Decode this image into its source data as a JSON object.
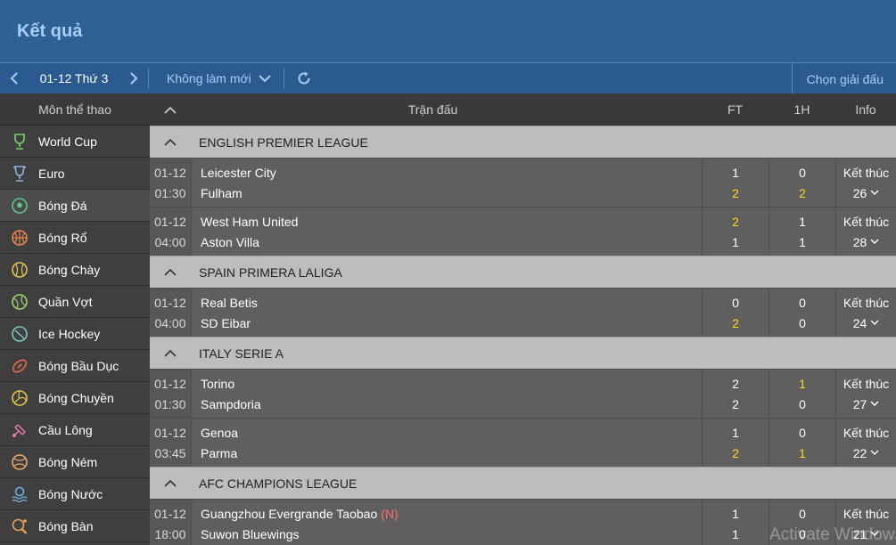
{
  "header": {
    "title": "Kết quả"
  },
  "toolbar": {
    "date": "01-12 Thứ 3",
    "refresh_mode": "Không làm mới",
    "choose_league": "Chọn giải đấu"
  },
  "sidebar": {
    "heading": "Môn thể thao",
    "items": [
      {
        "label": "World Cup",
        "icon": "trophy-icon",
        "active": false
      },
      {
        "label": "Euro",
        "icon": "cup-icon",
        "active": false
      },
      {
        "label": "Bóng Đá",
        "icon": "soccer-ball-icon",
        "active": true
      },
      {
        "label": "Bóng Rổ",
        "icon": "basketball-icon",
        "active": false
      },
      {
        "label": "Bóng Chày",
        "icon": "baseball-icon",
        "active": false
      },
      {
        "label": "Quần Vợt",
        "icon": "tennis-ball-icon",
        "active": false
      },
      {
        "label": "Ice Hockey",
        "icon": "hockey-puck-icon",
        "active": false
      },
      {
        "label": "Bóng Bầu Dục",
        "icon": "rugby-ball-icon",
        "active": false
      },
      {
        "label": "Bóng Chuyền",
        "icon": "volleyball-icon",
        "active": false
      },
      {
        "label": "Cầu Lông",
        "icon": "shuttlecock-icon",
        "active": false
      },
      {
        "label": "Bóng Ném",
        "icon": "handball-icon",
        "active": false
      },
      {
        "label": "Bóng Nước",
        "icon": "water-polo-icon",
        "active": false
      },
      {
        "label": "Bóng Bàn",
        "icon": "table-tennis-icon",
        "active": false
      }
    ]
  },
  "table": {
    "columns": {
      "match": "Trận đấu",
      "ft": "FT",
      "h1": "1H",
      "info": "Info"
    },
    "leagues": [
      {
        "name": "ENGLISH PREMIER LEAGUE",
        "matches": [
          {
            "date": "01-12",
            "time": "01:30",
            "home": "Leicester City",
            "away": "Fulham",
            "ft_home": "1",
            "ft_away": "2",
            "h1_home": "0",
            "h1_away": "2",
            "status": "Kết thúc",
            "count": "26",
            "ft_home_hl": false,
            "ft_away_hl": true,
            "h1_home_hl": false,
            "h1_away_hl": true,
            "neutral": ""
          },
          {
            "date": "01-12",
            "time": "04:00",
            "home": "West Ham United",
            "away": "Aston Villa",
            "ft_home": "2",
            "ft_away": "1",
            "h1_home": "1",
            "h1_away": "1",
            "status": "Kết thúc",
            "count": "28",
            "ft_home_hl": true,
            "ft_away_hl": false,
            "h1_home_hl": false,
            "h1_away_hl": false,
            "neutral": ""
          }
        ]
      },
      {
        "name": "SPAIN PRIMERA LALIGA",
        "matches": [
          {
            "date": "01-12",
            "time": "04:00",
            "home": "Real Betis",
            "away": "SD Eibar",
            "ft_home": "0",
            "ft_away": "2",
            "h1_home": "0",
            "h1_away": "0",
            "status": "Kết thúc",
            "count": "24",
            "ft_home_hl": false,
            "ft_away_hl": true,
            "h1_home_hl": false,
            "h1_away_hl": false,
            "neutral": ""
          }
        ]
      },
      {
        "name": "ITALY SERIE A",
        "matches": [
          {
            "date": "01-12",
            "time": "01:30",
            "home": "Torino",
            "away": "Sampdoria",
            "ft_home": "2",
            "ft_away": "2",
            "h1_home": "1",
            "h1_away": "0",
            "status": "Kết thúc",
            "count": "27",
            "ft_home_hl": false,
            "ft_away_hl": false,
            "h1_home_hl": true,
            "h1_away_hl": false,
            "neutral": ""
          },
          {
            "date": "01-12",
            "time": "03:45",
            "home": "Genoa",
            "away": "Parma",
            "ft_home": "1",
            "ft_away": "2",
            "h1_home": "0",
            "h1_away": "1",
            "status": "Kết thúc",
            "count": "22",
            "ft_home_hl": false,
            "ft_away_hl": true,
            "h1_home_hl": false,
            "h1_away_hl": true,
            "neutral": ""
          }
        ]
      },
      {
        "name": "AFC CHAMPIONS LEAGUE",
        "matches": [
          {
            "date": "01-12",
            "time": "18:00",
            "home": "Guangzhou Evergrande Taobao",
            "away": "Suwon Bluewings",
            "ft_home": "1",
            "ft_away": "1",
            "h1_home": "0",
            "h1_away": "0",
            "status": "Kết thúc",
            "count": "21",
            "ft_home_hl": false,
            "ft_away_hl": false,
            "h1_home_hl": false,
            "h1_away_hl": false,
            "neutral": "(N)"
          }
        ]
      }
    ]
  },
  "watermark": "Activate Windows",
  "colors": {
    "header_bg": "#2e6196",
    "title": "#a9cdf3",
    "highlight": "#ffd91a",
    "neutral_mark": "#ff6e6e"
  }
}
